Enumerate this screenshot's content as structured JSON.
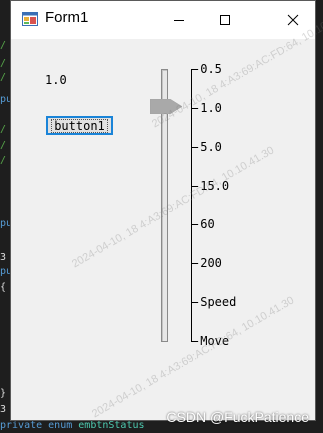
{
  "window": {
    "title": "Form1",
    "icon": "winforms-app-icon",
    "controls": {
      "minimize": "minimize-icon",
      "maximize": "maximize-icon",
      "close": "close-icon"
    }
  },
  "form": {
    "value_label": "1.0",
    "button_label": "button1",
    "slider": {
      "selected": "1.0",
      "ticks": [
        "0.5",
        "1.0",
        "5.0",
        "15.0",
        "60",
        "200",
        "Speed",
        "Move"
      ]
    }
  },
  "background_code": {
    "lines": [
      {
        "text": "/",
        "color": "#57a64a"
      },
      {
        "text": "/",
        "color": "#57a64a"
      },
      {
        "text": "/",
        "color": "#57a64a"
      },
      {
        "text": "pu",
        "color": "#569cd6"
      },
      {
        "text": "/",
        "color": "#57a64a"
      },
      {
        "text": "/",
        "color": "#57a64a"
      },
      {
        "text": "/",
        "color": "#57a64a"
      },
      {
        "text": "pu",
        "color": "#569cd6"
      },
      {
        "text": "3",
        "color": "#dcdcdc"
      },
      {
        "text": "pu",
        "color": "#569cd6"
      },
      {
        "text": "{",
        "color": "#dcdcdc"
      },
      {
        "text": "}",
        "color": "#dcdcdc"
      },
      {
        "text": "3",
        "color": "#dcdcdc"
      }
    ],
    "last_line_keyword": "private enum",
    "last_line_name": "embtnStatus"
  },
  "watermark": "2024-04-10, 18 4:A3:69:AC:FD:64, 10.10.41.30",
  "credit": "CSDN @FuckPatience"
}
